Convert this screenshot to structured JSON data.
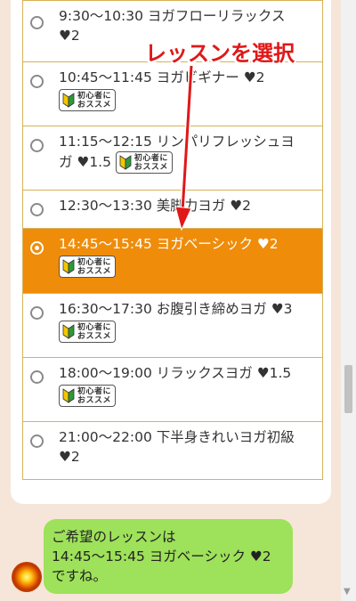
{
  "lessons": [
    {
      "time": "9:30～10:30",
      "name": "ヨガフローリラックス",
      "hearts": "♥2",
      "beginner": false,
      "selected": false
    },
    {
      "time": "10:45～11:45",
      "name": "ヨガビギナー",
      "hearts": "♥2",
      "beginner": true,
      "selected": false
    },
    {
      "time": "11:15～12:15",
      "name": "リンパリフレッシュヨガ",
      "hearts": "♥1.5",
      "beginner": true,
      "selected": false
    },
    {
      "time": "12:30～13:30",
      "name": "美脚力ヨガ",
      "hearts": "♥2",
      "beginner": false,
      "selected": false
    },
    {
      "time": "14:45～15:45",
      "name": "ヨガベーシック",
      "hearts": "♥2",
      "beginner": true,
      "selected": true
    },
    {
      "time": "16:30～17:30",
      "name": "お腹引き締めヨガ",
      "hearts": "♥3",
      "beginner": true,
      "selected": false
    },
    {
      "time": "18:00～19:00",
      "name": "リラックスヨガ",
      "hearts": "♥1.5",
      "beginner": true,
      "selected": false
    },
    {
      "time": "21:00～22:00",
      "name": "下半身きれいヨガ初級",
      "hearts": "♥2",
      "beginner": false,
      "selected": false
    }
  ],
  "lines": {
    "l0a": "9:30～10:30 ヨガフローリラックス",
    "l0b": "♥2",
    "l1a": "10:45～11:45 ヨガビギナー ♥2",
    "l2a": "11:15～12:15 リンパリフレッシュヨ",
    "l2b": "ガ ♥1.5",
    "l3a": "12:30～13:30 美脚力ヨガ ♥2",
    "l4a": "14:45～15:45 ヨガベーシック ♥2",
    "l5a": "16:30～17:30 お腹引き締めヨガ ♥3",
    "l6a": "18:00～19:00 リラックスヨガ ♥1.5",
    "l7a": "21:00～22:00 下半身きれいヨガ初級",
    "l7b": "♥2"
  },
  "badge": {
    "line1": "初心者に",
    "line2": "おススメ"
  },
  "annotation": {
    "text": "レッスンを選択"
  },
  "chat": {
    "line1": "ご希望のレッスンは",
    "line2": "14:45～15:45 ヨガベーシック ♥2",
    "line3": "ですね。"
  },
  "colors": {
    "selected_bg": "#ef8c0a",
    "border": "#d7b25a",
    "bubble": "#9ee15a",
    "annotation": "#e01818",
    "page_bg": "#f6e6d9"
  }
}
